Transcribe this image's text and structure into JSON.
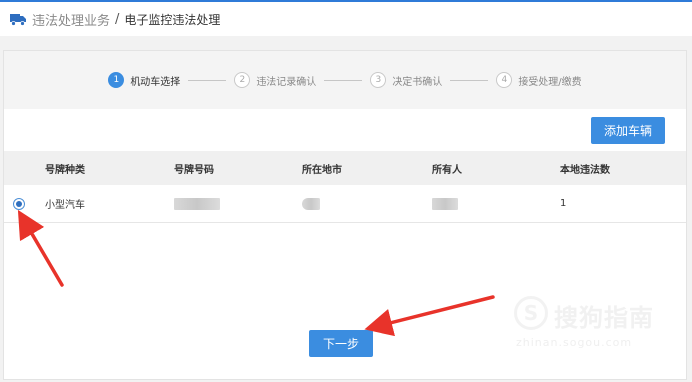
{
  "breadcrumb": {
    "icon": "truck-icon",
    "main": "违法处理业务",
    "separator": "/",
    "current": "电子监控违法处理"
  },
  "stepper": {
    "steps": [
      {
        "num": "1",
        "label": "机动车选择",
        "active": true
      },
      {
        "num": "2",
        "label": "违法记录确认",
        "active": false
      },
      {
        "num": "3",
        "label": "决定书确认",
        "active": false
      },
      {
        "num": "4",
        "label": "接受处理/缴费",
        "active": false
      }
    ]
  },
  "add_button": "添加车辆",
  "table": {
    "headers": [
      "号牌种类",
      "号牌号码",
      "所在地市",
      "所有人",
      "本地违法数"
    ],
    "rows": [
      {
        "selected": true,
        "plate_type": "小型汽车",
        "plate_number": "",
        "city": "",
        "owner": "",
        "local_violations": "1"
      }
    ]
  },
  "next_button": "下一步",
  "watermark": {
    "logo": "S",
    "text": "搜狗指南",
    "url": "zhinan.sogou.com"
  },
  "colors": {
    "accent": "#3b8de0",
    "annotation": "#e8332a",
    "header_bg": "#f0f0f0"
  }
}
